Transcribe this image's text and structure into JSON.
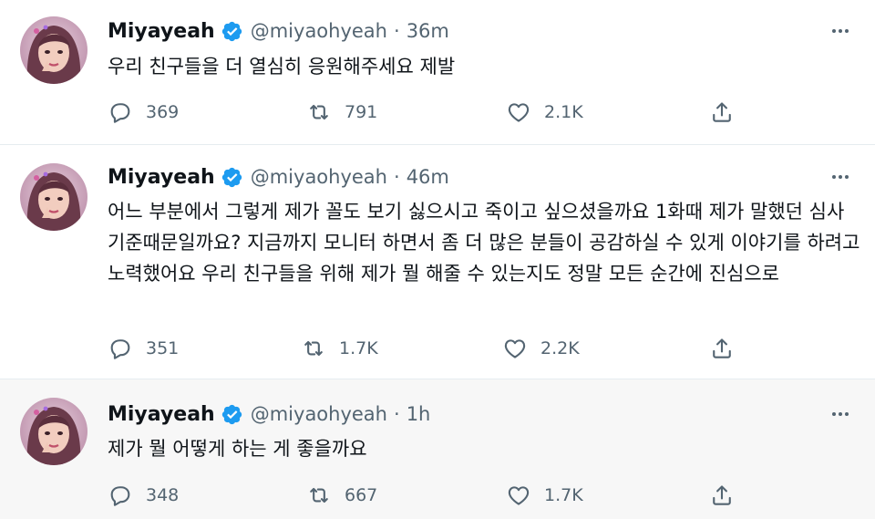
{
  "colors": {
    "text_primary": "#0f1419",
    "text_secondary": "#536471",
    "verified_blue": "#1d9bf0",
    "divider": "#e6ecf0",
    "hover_bg": "#f7f7f7"
  },
  "icons": {
    "verified": "verified-badge-icon",
    "more": "more-dots-icon",
    "reply": "reply-icon",
    "retweet": "retweet-icon",
    "like": "heart-icon",
    "share": "share-icon"
  },
  "tweets": [
    {
      "name": "Miyayeah",
      "handle": "@miyaohyeah",
      "separator": "·",
      "time": "36m",
      "text": "우리 친구들을 더 열심히 응원해주세요 제발",
      "replies": "369",
      "retweets": "791",
      "likes": "2.1K"
    },
    {
      "name": "Miyayeah",
      "handle": "@miyaohyeah",
      "separator": "·",
      "time": "46m",
      "text": "어느 부분에서 그렇게 제가 꼴도 보기 싫으시고 죽이고 싶으셨을까요 1화때 제가 말했던 심사기준때문일까요? 지금까지 모니터 하면서 좀 더 많은 분들이 공감하실 수 있게 이야기를 하려고 노력했어요 우리 친구들을 위해 제가 뭘 해줄 수 있는지도 정말 모든 순간에 진심으로",
      "replies": "351",
      "retweets": "1.7K",
      "likes": "2.2K"
    },
    {
      "name": "Miyayeah",
      "handle": "@miyaohyeah",
      "separator": "·",
      "time": "1h",
      "text": "제가 뭘 어떻게 하는 게 좋을까요",
      "replies": "348",
      "retweets": "667",
      "likes": "1.7K"
    }
  ]
}
